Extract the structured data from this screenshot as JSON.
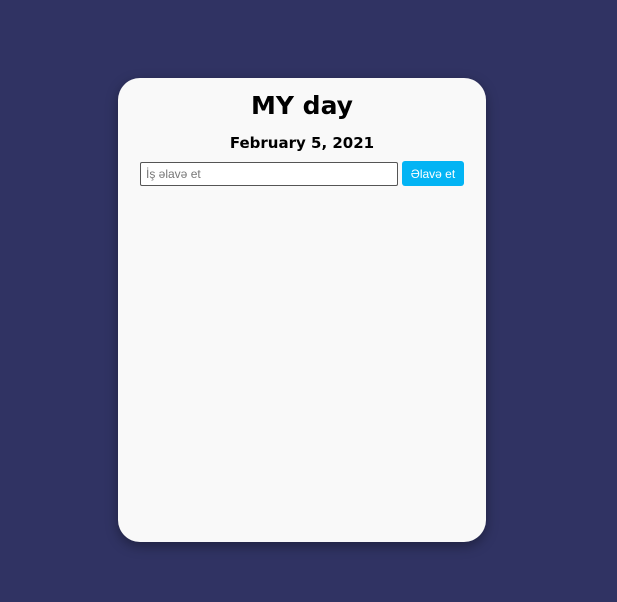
{
  "app": {
    "title": "MY day",
    "date": "February 5, 2021"
  },
  "add_form": {
    "input_value": "",
    "input_placeholder": "İş əlavə et",
    "button_label": "Əlavə et"
  },
  "tasks": [],
  "colors": {
    "background": "#303363",
    "card": "#f9f9f9",
    "accent": "#03b4f4"
  }
}
